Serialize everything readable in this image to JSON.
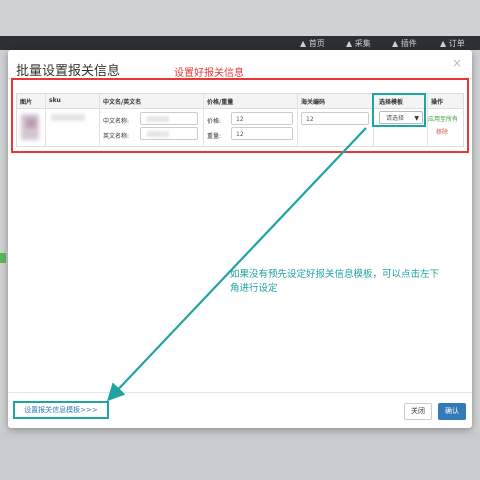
{
  "background": {
    "nav_items": [
      "▲ 首页",
      "▲ 采集",
      "▲ 插件",
      "▲ 订单"
    ]
  },
  "modal": {
    "title": "批量设置报关信息",
    "close_icon": "close-icon",
    "annotation_top": "设置好报关信息",
    "table": {
      "headers": [
        "图片",
        "sku",
        "中文名/英文名",
        "价格/重量",
        "海关编码",
        "选择模板",
        "操作"
      ],
      "row": {
        "cn_name_label": "中文名称:",
        "en_name_label": "英文名称:",
        "price_label": "价格:",
        "price_value": "12",
        "weight_label": "重量:",
        "weight_value": "12",
        "customs_code_value": "12",
        "template_select": "请选择",
        "apply_all_link": "应用至所有",
        "remove_link": "移除"
      }
    },
    "annotation_middle": "如果没有预先设定好报关信息模板，可以点击左下角进行设定",
    "footer": {
      "template_link": "设置报关信息模板>>>",
      "close_button": "关闭",
      "confirm_button": "确认"
    }
  },
  "colors": {
    "red_annotation": "#e53935",
    "teal_annotation": "#1fa3a3",
    "primary_button": "#337ab7",
    "apply_link": "#3c9c3c",
    "remove_link": "#d9534f"
  }
}
